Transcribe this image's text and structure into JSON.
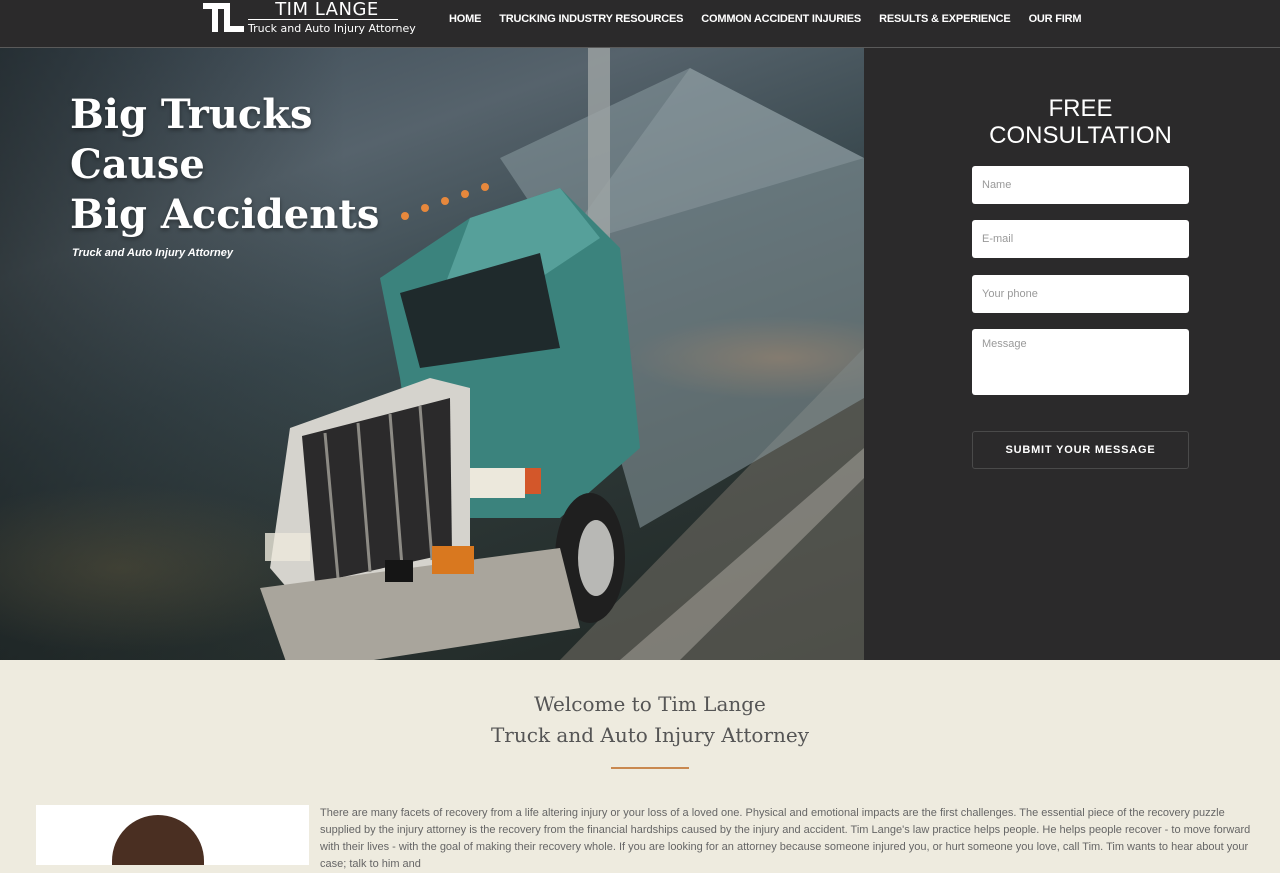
{
  "header": {
    "logo_name": "TIM LANGE",
    "logo_sub": "Truck and Auto Injury Attorney",
    "nav": [
      "HOME",
      "TRUCKING INDUSTRY RESOURCES",
      "COMMON ACCIDENT INJURIES",
      "RESULTS & EXPERIENCE",
      "OUR FIRM"
    ]
  },
  "hero": {
    "title_lines": [
      "Big Trucks",
      "Cause",
      "Big Accidents"
    ],
    "subtitle": "Truck and Auto Injury Attorney"
  },
  "consult": {
    "title_line1": "FREE",
    "title_line2": "CONSULTATION",
    "name_placeholder": "Name",
    "email_placeholder": "E-mail",
    "phone_placeholder": "Your phone",
    "message_placeholder": "Message",
    "submit_label": "SUBMIT YOUR MESSAGE"
  },
  "welcome": {
    "line1": "Welcome to Tim Lange",
    "line2": "Truck and Auto Injury Attorney",
    "intro": "There are many facets of recovery from a life altering injury or your loss of a loved one. Physical and emotional impacts are the first challenges. The essential piece of the recovery puzzle supplied by the injury attorney is the recovery from the financial hardships caused by the injury and accident. Tim Lange's law practice helps people. He helps people recover - to move forward with their lives - with the goal of making their recovery whole. If you are looking for an attorney because someone injured you, or hurt someone you love, call Tim. Tim wants to hear about your case; talk to him and"
  },
  "colors": {
    "header_bg": "#2b2a2b",
    "panel_bg": "#2b2a2b",
    "section_bg": "#eeebdf",
    "accent": "#c9884f",
    "truck_teal": "#3f8f88"
  },
  "icons": [
    "tl-logo-icon"
  ]
}
